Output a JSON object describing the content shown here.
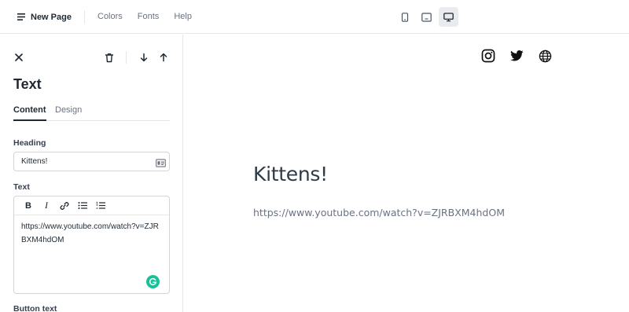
{
  "header": {
    "page_title": "New Page",
    "nav": [
      "Colors",
      "Fonts",
      "Help"
    ],
    "devices": [
      {
        "icon": "mobile-icon",
        "active": false
      },
      {
        "icon": "tablet-icon",
        "active": false
      },
      {
        "icon": "desktop-icon",
        "active": true
      }
    ]
  },
  "panel": {
    "title": "Text",
    "tabs": [
      "Content",
      "Design"
    ],
    "active_tab": "Content",
    "heading_label": "Heading",
    "heading_value": "Kittens!",
    "text_label": "Text",
    "text_value": "https://www.youtube.com/watch?v=ZJRBXM4hdOM",
    "toolbar": {
      "bold": "B",
      "italic": "I"
    },
    "button_text_label": "Button text"
  },
  "preview": {
    "heading": "Kittens!",
    "text": "https://www.youtube.com/watch?v=ZJRBXM4hdOM",
    "social_icons": [
      "instagram-icon",
      "twitter-icon",
      "globe-icon"
    ]
  },
  "colors": {
    "accent": "#1f2933",
    "grammarly": "#15c39a",
    "border": "#e5e7eb"
  }
}
